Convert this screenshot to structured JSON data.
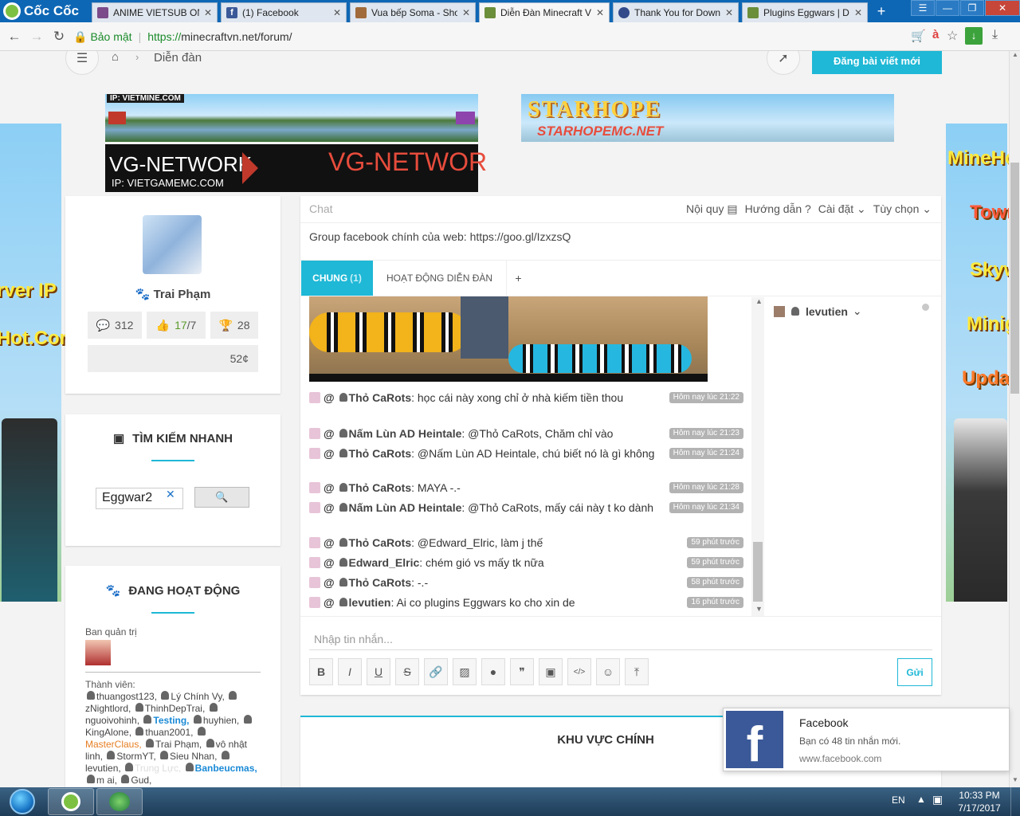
{
  "browser": {
    "brand": "Cốc Cốc",
    "tabs": [
      {
        "title": "ANIME VIETSUB ONLINE",
        "icon": "anime-tab-icon",
        "color": "#7b4b8a"
      },
      {
        "title": "(1) Facebook",
        "icon": "facebook-tab-icon",
        "color": "#3b5998"
      },
      {
        "title": "Vua bếp Soma - Shokugeki",
        "icon": "anime-tab-icon",
        "color": "#a06a3a"
      },
      {
        "title": "Diễn Đàn Minecraft Việt Nam",
        "icon": "minecraft-tab-icon",
        "color": "#6b8e3a",
        "active": true
      },
      {
        "title": "Thank You for Downloading",
        "icon": "download-tab-icon",
        "color": "#334a8a"
      },
      {
        "title": "Plugins Eggwars | Diễn Đàn",
        "icon": "minecraft-tab-icon",
        "color": "#6b8e3a"
      }
    ],
    "security_label": "Bảo mật",
    "url_scheme": "https://",
    "url_rest": "minecraftvn.net/forum/"
  },
  "header": {
    "breadcrumb": "Diễn đàn",
    "post_button": "Đăng bài viết mới"
  },
  "ads": {
    "vietmine": "IP: VIETMINE.COM",
    "vg_title": "VG-NETWORK",
    "vg_ip": "IP: VIETGAMEMC.COM",
    "vg_repeat": "VG-NETWOR",
    "starhope": "STARHOPE",
    "starhope_site": "STARHOPEMC.NET",
    "left_lines": [
      "rver IP",
      "Hot.Com"
    ],
    "right_lines": [
      "MineHot",
      "Town",
      "Skyw",
      "Minig",
      "Updat"
    ]
  },
  "profile": {
    "name": "Trai Phạm",
    "posts": "312",
    "likes": "17",
    "likes_total": "/7",
    "trophies": "28",
    "credits": "52¢"
  },
  "search": {
    "title": "TÌM KIẾM NHANH",
    "value": "Eggwar2"
  },
  "activity": {
    "title": "ĐANG HOẠT ĐỘNG",
    "admins_label": "Ban quản trị",
    "members_label": "Thành viên:",
    "members": [
      "thuangost123,",
      "Lý Chính Vy,",
      "zNightlord,",
      "ThinhDepTrai,",
      "nguoivohinh,",
      "Testing,",
      "huyhien,",
      "KingAlone,",
      "thuan2001,",
      "MasterClaus,",
      "Trai Phạm,",
      "vô nhật linh,",
      "StormYT,",
      "Sieu Nhan,",
      "levutien,",
      "Trung Lực,",
      "Banbeucmas,",
      "m ai,",
      "Gud,"
    ]
  },
  "chat": {
    "title": "Chat",
    "links": [
      "Nội quy",
      "Hướng dẫn",
      "Cài đặt",
      "Tùy chọn"
    ],
    "notice": "Group facebook chính của web: https://goo.gl/IzxzsQ",
    "tabs": [
      "CHUNG",
      "HOẠT ĐỘNG DIỄN ĐÀN",
      "+"
    ],
    "tab_badge": "(1)",
    "online_user": "levutien",
    "messages": [
      {
        "user": "Thỏ CaRots",
        "text": "học cái này xong chỉ ở nhà kiếm tiền thou",
        "time": "Hôm nay lúc 21:22"
      },
      {
        "user": "Nấm Lùn AD Heintale",
        "text": "@Thỏ CaRots, Chăm chỉ vào",
        "time": "Hôm nay lúc 21:23"
      },
      {
        "user": "Thỏ CaRots",
        "text": "@Nấm Lùn AD Heintale, chú biết nó là gì không",
        "time": "Hôm nay lúc 21:24"
      },
      {
        "user": "Thỏ CaRots",
        "text": "MAYA -.-",
        "time": "Hôm nay lúc 21:28"
      },
      {
        "user": "Nấm Lùn AD Heintale",
        "text": "@Thỏ CaRots, mấy cái này t ko dành",
        "time": "Hôm nay lúc 21:34"
      },
      {
        "user": "Thỏ CaRots",
        "text": "@Edward_Elric, làm j thế",
        "time": "59 phút trước"
      },
      {
        "user": "Edward_Elric",
        "text": "chém gió vs mấy tk nữa",
        "time": "59 phút trước"
      },
      {
        "user": "Thỏ CaRots",
        "text": "-.-",
        "time": "58 phút trước"
      },
      {
        "user": "levutien",
        "text": "Ai co plugins Eggwars ko cho xin de",
        "time": "16 phút trước"
      }
    ],
    "input_placeholder": "Nhập tin nhắn...",
    "send_label": "Gửi"
  },
  "main_section": {
    "title": "KHU VỰC CHÍNH"
  },
  "toast": {
    "title": "Facebook",
    "body": "Bạn có 48 tin nhắn mới.",
    "site": "www.facebook.com"
  },
  "taskbar": {
    "lang": "EN",
    "time": "10:33 PM",
    "date": "7/17/2017"
  }
}
